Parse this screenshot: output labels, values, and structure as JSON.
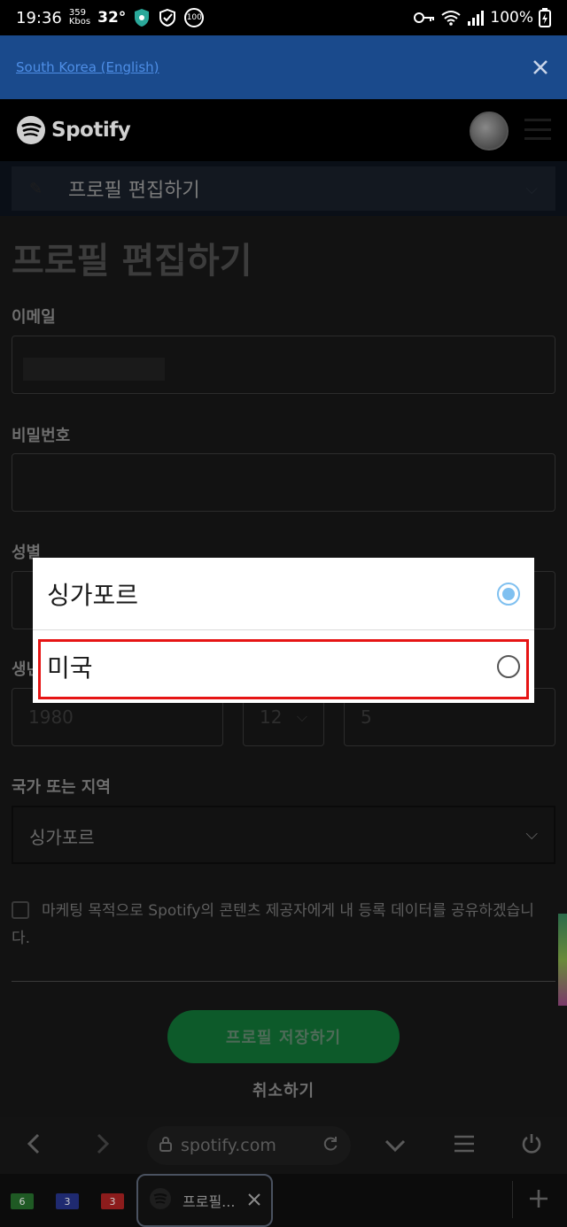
{
  "status_bar": {
    "time": "19:36",
    "speed_value": "359",
    "speed_unit": "Kbos",
    "temperature": "32°",
    "badge_number": "100",
    "battery": "100%"
  },
  "locale_banner": {
    "link_text": "South Korea (English)"
  },
  "header": {
    "brand": "Spotify"
  },
  "section_nav": {
    "label": "프로필 편집하기"
  },
  "form": {
    "title": "프로필 편집하기",
    "email_label": "이메일",
    "password_label": "비밀번호",
    "gender_label": "성별",
    "birthdate_label": "생년",
    "birth_year": "1980",
    "birth_month": "12",
    "birth_day": "5",
    "country_label": "국가 또는 지역",
    "country_value": "싱가포르",
    "consent_text": "마케팅 목적으로 Spotify의 콘텐츠 제공자에게 내 등록 데이터를 공유하겠습니다.",
    "save_button": "프로필 저장하기",
    "cancel_link": "취소하기"
  },
  "dialog": {
    "options": [
      {
        "label": "싱가포르",
        "selected": true
      },
      {
        "label": "미국",
        "selected": false
      }
    ],
    "highlight_color": "#e61414"
  },
  "browser_bar": {
    "url": "spotify.com"
  },
  "tab_strip": {
    "tab_counts": [
      "6",
      "3",
      "3"
    ],
    "tab_colors": [
      "#2e7d32",
      "#283593",
      "#c62828"
    ],
    "active_tab_title": "프로필..."
  },
  "colors": {
    "spotify_green": "#1db954",
    "banner_blue": "#1a4a8c"
  }
}
